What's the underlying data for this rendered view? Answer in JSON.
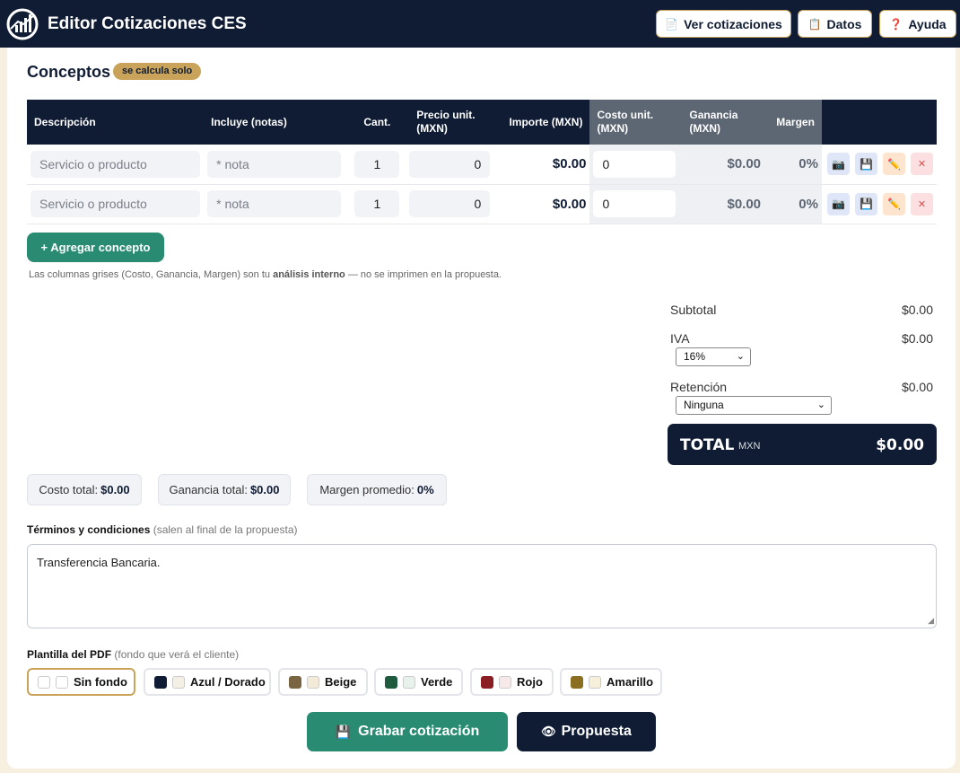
{
  "header": {
    "title": "Editor Cotizaciones CES",
    "buttons": {
      "cotizaciones": "Ver cotizaciones",
      "datos": "Datos",
      "ayuda": "Ayuda"
    }
  },
  "conceptos": {
    "title": "Conceptos",
    "badge": "se calcula solo",
    "columns": {
      "descripcion": "Descripción",
      "incluye": "Incluye (notas)",
      "cant": "Cant.",
      "precio_1": "Precio unit.",
      "precio_2": "(MXN)",
      "importe": "Importe (MXN)",
      "costo_1": "Costo unit.",
      "costo_2": "(MXN)",
      "ganancia_1": "Ganancia",
      "ganancia_2": "(MXN)",
      "margen": "Margen"
    },
    "rows": [
      {
        "descripcion_placeholder": "Servicio o producto",
        "nota_placeholder": "* nota",
        "cant": "1",
        "precio": "0",
        "importe": "$0.00",
        "costo": "0",
        "ganancia": "$0.00",
        "margen": "0%"
      },
      {
        "descripcion_placeholder": "Servicio o producto",
        "nota_placeholder": "* nota",
        "cant": "1",
        "precio": "0",
        "importe": "$0.00",
        "costo": "0",
        "ganancia": "$0.00",
        "margen": "0%"
      }
    ],
    "add_button": "+ Agregar concepto",
    "note_pre": "Las columnas grises (Costo, Ganancia, Margen) son tu ",
    "note_bold": "análisis interno",
    "note_post": " — no se imprimen en la propuesta."
  },
  "summary": {
    "subtotal_label": "Subtotal",
    "subtotal_value": "$0.00",
    "iva_label": "IVA",
    "iva_value": "$0.00",
    "iva_select": "16%",
    "retencion_label": "Retención",
    "retencion_value": "$0.00",
    "retencion_select": "Ninguna",
    "total_label": "TOTAL",
    "total_currency": "MXN",
    "total_value": "$0.00"
  },
  "stats": {
    "costo_label": "Costo total:",
    "costo_value": "$0.00",
    "ganancia_label": "Ganancia total:",
    "ganancia_value": "$0.00",
    "margen_label": "Margen promedio:",
    "margen_value": "0%"
  },
  "terms": {
    "label": "Términos y condiciones",
    "hint": "(salen al final de la propuesta)",
    "value": "Transferencia Bancaria."
  },
  "templates": {
    "label": "Plantilla del PDF",
    "hint": "(fondo que verá el cliente)",
    "options": [
      {
        "label": "Sin fondo",
        "color1": "#ffffff",
        "color2": "#ffffff"
      },
      {
        "label": "Azul / Dorado",
        "color1": "#0f1c33",
        "color2": "#f5f0e6"
      },
      {
        "label": "Beige",
        "color1": "#7a6543",
        "color2": "#f3ead8"
      },
      {
        "label": "Verde",
        "color1": "#1f5c3f",
        "color2": "#e8f2ec"
      },
      {
        "label": "Rojo",
        "color1": "#8b1e22",
        "color2": "#f7e9ea"
      },
      {
        "label": "Amarillo",
        "color1": "#8a6e22",
        "color2": "#f6efda"
      }
    ]
  },
  "actions": {
    "grabar": "Grabar cotización",
    "propuesta": "Propuesta"
  },
  "colors": {
    "navy": "#0f1c33",
    "gold": "#c9a35a",
    "teal": "#2a8b73",
    "gray_col": "#5d6673"
  }
}
